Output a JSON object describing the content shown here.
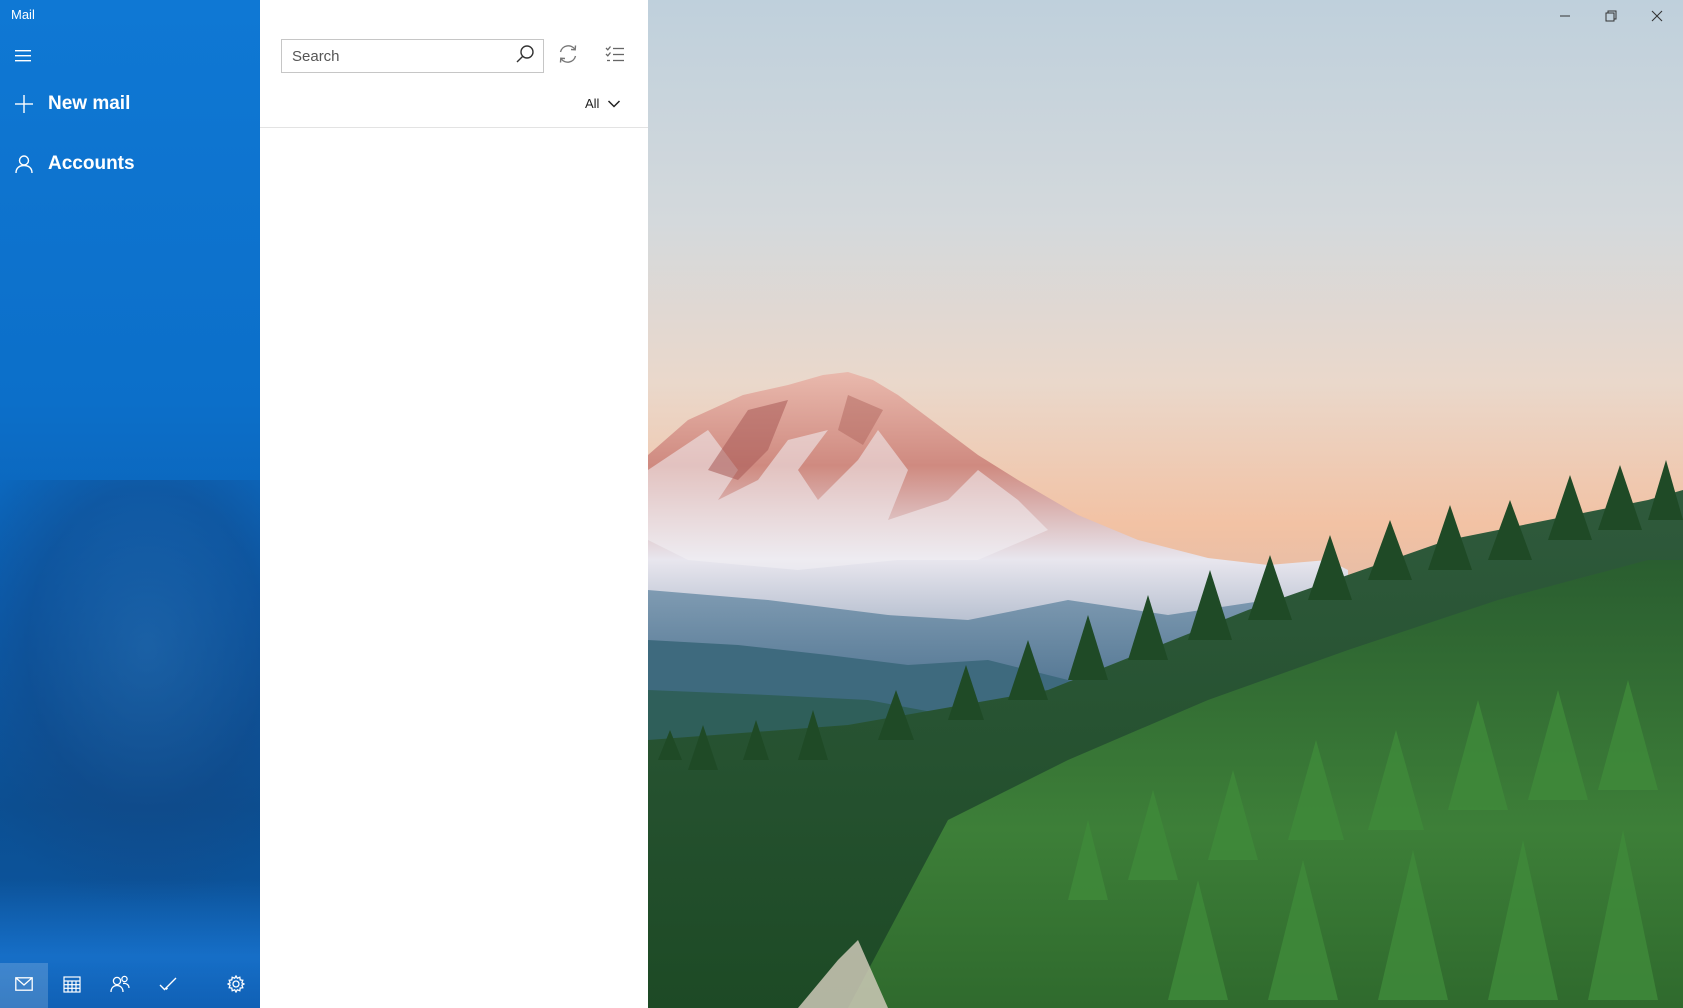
{
  "window": {
    "title": "Mail",
    "controls": [
      "minimize-icon",
      "restore-icon",
      "close-icon"
    ]
  },
  "nav": {
    "menu_icon": "hamburger-icon",
    "items": [
      {
        "label": "New mail",
        "icon": "plus-icon"
      },
      {
        "label": "Accounts",
        "icon": "person-icon"
      }
    ],
    "bottom_bar": [
      {
        "name": "mail",
        "icon": "mail-icon",
        "active": true
      },
      {
        "name": "calendar",
        "icon": "calendar-icon",
        "active": false
      },
      {
        "name": "people",
        "icon": "people-icon",
        "active": false
      },
      {
        "name": "to-do",
        "icon": "checkmark-icon",
        "active": false
      },
      {
        "name": "settings",
        "icon": "gear-icon",
        "active": false
      }
    ]
  },
  "message_list": {
    "search": {
      "placeholder": "Search",
      "value": ""
    },
    "filter": {
      "selected": "All"
    }
  },
  "colors": {
    "accent": "#0f78d4",
    "nav_text": "#ffffff"
  }
}
